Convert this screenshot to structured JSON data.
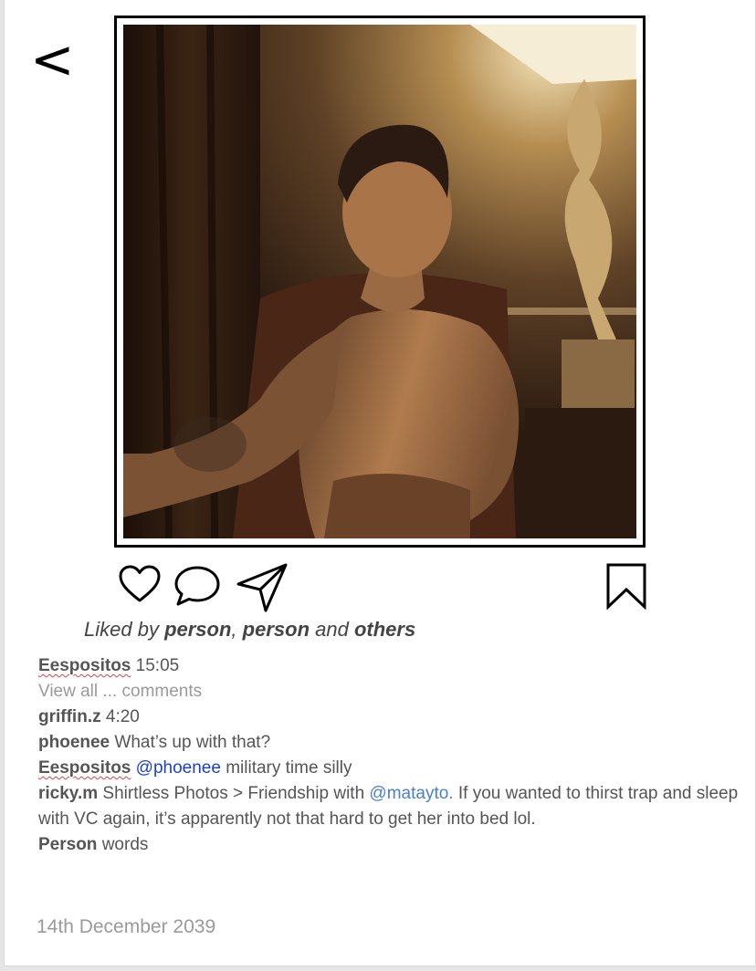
{
  "nav": {
    "back_label": "<"
  },
  "post": {
    "photo_alt": "Shirtless man seated in a chair beside a lamp",
    "likes": {
      "prefix": "Liked by ",
      "user1": "person",
      "separator": ", ",
      "user2": "person",
      "conjunction": " and ",
      "others": "others"
    }
  },
  "icons": {
    "like": "heart-icon",
    "comment": "comment-bubble-icon",
    "share": "paper-plane-icon",
    "save": "bookmark-icon"
  },
  "comments": [
    {
      "user": "Eespositos",
      "text": " 15:05"
    },
    {
      "view_all": "View all ... comments"
    },
    {
      "user": "griffin.z",
      "text": " 4:20"
    },
    {
      "user": "phoenee",
      "text": " What’s up with that?"
    },
    {
      "user": "Eespositos",
      "mention": "@phoenee",
      "text": " military time silly"
    },
    {
      "user": "ricky.m",
      "text_before": " Shirtless Photos > Friendship with ",
      "mention": "@matayto.",
      "text_after": " If you wanted to thirst trap and sleep with VC again, it’s apparently not that hard to get her into bed lol."
    },
    {
      "user": "Person",
      "text": " words"
    }
  ],
  "date": "14th December 2039",
  "colors": {
    "mention_primary": "#1a3fd0",
    "mention_secondary": "#4a7fd0",
    "muted_text": "#9a9a9a",
    "spellcheck_squiggle": "#e04040"
  }
}
